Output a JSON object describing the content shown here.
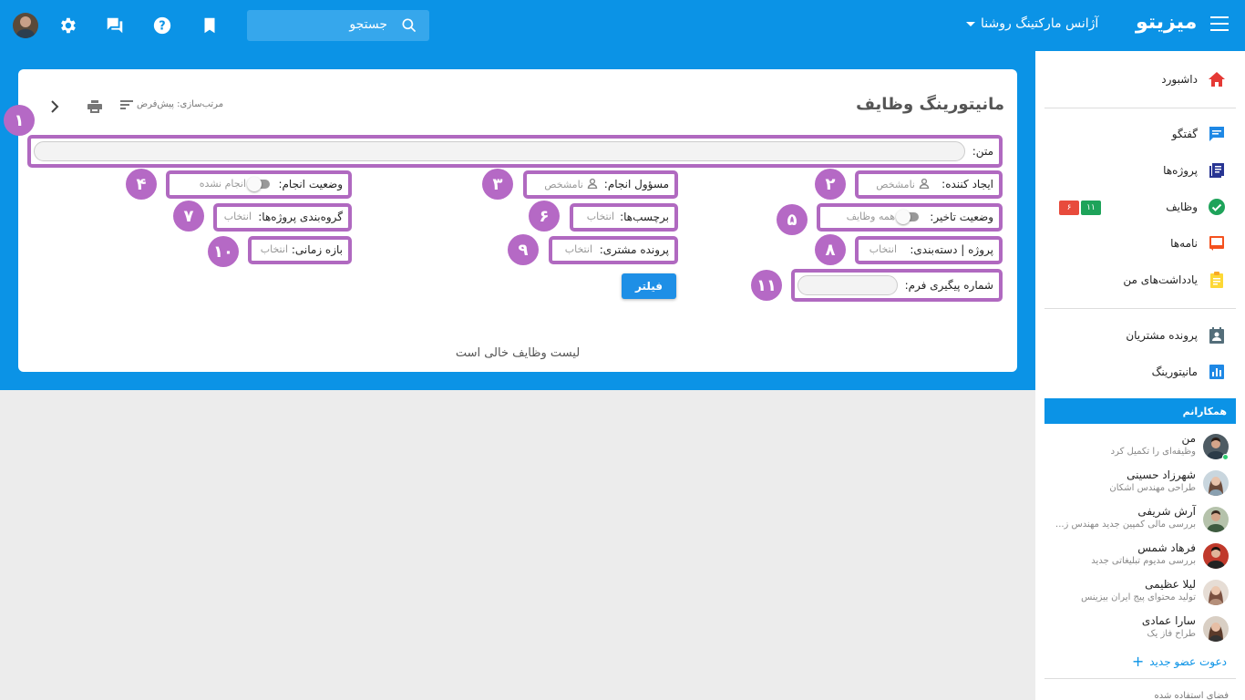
{
  "topbar": {
    "brand": "میزیتو",
    "agency": "آژانس مارکتینگ روشنا",
    "search_label": "جستجو"
  },
  "card": {
    "title": "مانیتورینگ وظایف",
    "sort_label": "مرتب‌سازی: پیش‌فرض",
    "text_label": "متن:",
    "fields": {
      "creator_label": "ایجاد کننده:",
      "creator_value": "نامشخص",
      "assignee_label": "مسؤول انجام:",
      "assignee_value": "نامشخص",
      "status_label": "وضعیت انجام:",
      "status_value": "انجام نشده",
      "delay_label": "وضعیت تاخیر:",
      "delay_value": "همه وظایف",
      "tags_label": "برچسب‌ها:",
      "tags_value": "انتخاب",
      "grouping_label": "گروه‌بندی پروژه‌ها:",
      "grouping_value": "انتخاب",
      "project_label": "پروژه | دسته‌بندی:",
      "project_value": "انتخاب",
      "customer_label": "پرونده مشتری:",
      "customer_value": "انتخاب",
      "period_label": "بازه زمانی:",
      "period_value": "انتخاب",
      "tracking_label": "شماره پیگیری فرم:"
    },
    "filter_button": "فیلتر",
    "empty_text": "لیست وظایف خالی است",
    "markers": [
      "۱",
      "۲",
      "۳",
      "۴",
      "۵",
      "۶",
      "۷",
      "۸",
      "۹",
      "۱۰",
      "۱۱"
    ]
  },
  "sidebar": {
    "items": [
      {
        "label": "داشبورد",
        "icon": "home-icon"
      },
      {
        "label": "گفتگو",
        "icon": "chat-icon"
      },
      {
        "label": "پروژه‌ها",
        "icon": "projects-icon"
      },
      {
        "label": "وظایف",
        "icon": "tasks-icon"
      },
      {
        "label": "نامه‌ها",
        "icon": "letters-icon"
      },
      {
        "label": "یادداشت‌های من",
        "icon": "notes-icon"
      },
      {
        "label": "پرونده مشتریان",
        "icon": "customers-icon"
      },
      {
        "label": "مانیتورینگ",
        "icon": "monitoring-icon"
      }
    ],
    "task_badges": {
      "green": "۱۱",
      "red": "۶"
    },
    "colleagues_title": "همکارانم",
    "members": [
      {
        "name": "من",
        "sub": "وظیفه‌ای را تکمیل کرد"
      },
      {
        "name": "شهرزاد حسینی",
        "sub": "طراحی مهندس اشکان"
      },
      {
        "name": "آرش شریفی",
        "sub": "بررسی مالی کمپین جدید مهندس ز..."
      },
      {
        "name": "فرهاد شمس",
        "sub": "بررسی مدیوم تبلیغاتی جدید"
      },
      {
        "name": "لیلا عظیمی",
        "sub": "تولید محتوای پیج ایران بیزینس"
      },
      {
        "name": "سارا عمادی",
        "sub": "طراح فاز یک"
      }
    ],
    "invite_label": "دعوت عضو جدید",
    "space_label": "فضای استفاده شده"
  },
  "colors": {
    "primary": "#0b93e6",
    "marker": "#b569c5",
    "badge_green": "#1ea35a",
    "badge_red": "#e84b3c"
  }
}
